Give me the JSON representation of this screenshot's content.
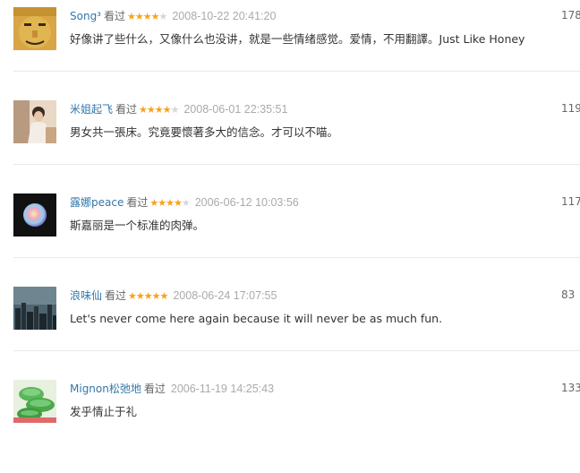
{
  "comments": [
    {
      "user": "Song³",
      "status": "看过",
      "rating": 4,
      "time": "2008-10-22 20:41:20",
      "votes": "178",
      "text": "好像讲了些什么，又像什么也没讲，就是一些情绪感觉。爱情，不用翻譯。Just Like Honey"
    },
    {
      "user": "米姐起飞",
      "status": "看过",
      "rating": 4,
      "time": "2008-06-01 22:35:51",
      "votes": "119",
      "text": "男女共一張床。究竟要懷著多大的信念。才可以不喵。"
    },
    {
      "user": "露娜peace",
      "status": "看过",
      "rating": 4,
      "time": "2006-06-12 10:03:56",
      "votes": "117",
      "text": "斯嘉丽是一个标准的肉弹。"
    },
    {
      "user": "浪味仙",
      "status": "看过",
      "rating": 5,
      "time": "2008-06-24 17:07:55",
      "votes": "83",
      "text": "Let's never come here again because it will never be as much fun."
    },
    {
      "user": "Mignon松弛地",
      "status": "看过",
      "rating": 0,
      "time": "2006-11-19 14:25:43",
      "votes": "133",
      "text": "发乎情止于礼"
    }
  ]
}
